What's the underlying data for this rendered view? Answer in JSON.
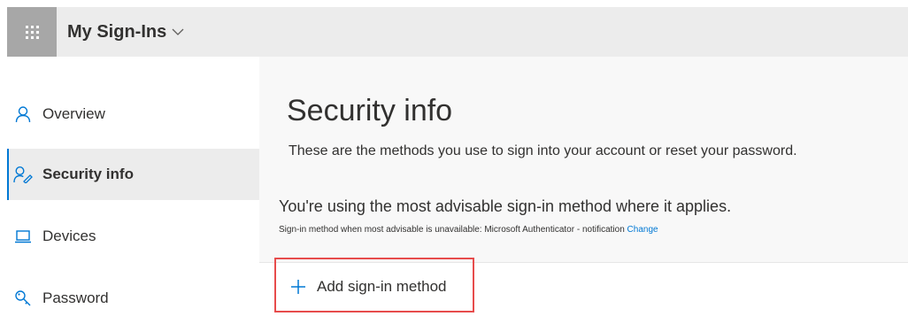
{
  "header": {
    "waffle_icon": "waffle-icon",
    "app_title": "My Sign-Ins",
    "chevron_icon": "chevron-down-icon"
  },
  "sidebar": {
    "items": [
      {
        "label": "Overview",
        "icon": "person-icon",
        "active": false
      },
      {
        "label": "Security info",
        "icon": "security-info-icon",
        "active": true
      },
      {
        "label": "Devices",
        "icon": "laptop-icon",
        "active": false
      },
      {
        "label": "Password",
        "icon": "key-icon",
        "active": false
      }
    ]
  },
  "main": {
    "title": "Security info",
    "subtitle": "These are the methods you use to sign into your account or reset your password.",
    "advisable_text": "You're using the most advisable sign-in method where it applies.",
    "note_text": "Sign-in method when most advisable is unavailable: Microsoft Authenticator - notification",
    "note_link": "Change",
    "add_method_label": "Add sign-in method"
  },
  "colors": {
    "accent": "#0078d4",
    "highlight_border": "#e74c4c",
    "header_bg": "#ececec",
    "waffle_bg": "#a7a7a7",
    "main_bg": "#f8f8f8"
  }
}
